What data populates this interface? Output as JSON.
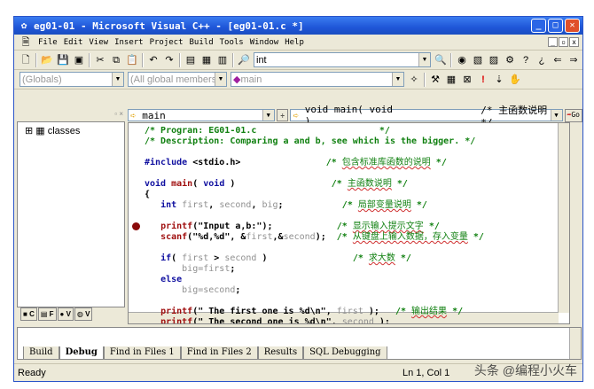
{
  "window": {
    "title": "eg01-01 - Microsoft Visual C++ - [eg01-01.c *]"
  },
  "menu": [
    "File",
    "Edit",
    "View",
    "Insert",
    "Project",
    "Build",
    "Tools",
    "Window",
    "Help"
  ],
  "toolbar": {
    "find_value": "int"
  },
  "wizardbar": {
    "class_combo": "(Globals)",
    "filter_combo": "(All global members",
    "member_combo": "main"
  },
  "left_pane": {
    "tree_root": "classes",
    "tabs": [
      "C",
      "F",
      "V",
      "V"
    ]
  },
  "editor": {
    "scope_combo": "main",
    "func_combo": "void main( void )",
    "func_comment": "/* 主函数说明 */",
    "go_label": "Go"
  },
  "code": [
    [
      [
        "/* Progran: EG01-01.c                       */",
        "cm"
      ]
    ],
    [
      [
        "/* Description: Comparing a and b, see which is the bigger. */",
        "cm"
      ]
    ],
    [],
    [
      [
        "#include",
        "kw"
      ],
      [
        " <stdio.h>                ",
        "tx"
      ],
      [
        "/* ",
        "cm"
      ],
      [
        "包含标准库函数的说明",
        "cn"
      ],
      [
        " */",
        "cm"
      ]
    ],
    [],
    [
      [
        "void",
        "kw"
      ],
      [
        " ",
        "tx"
      ],
      [
        "main",
        "fn"
      ],
      [
        "( ",
        "tx"
      ],
      [
        "void",
        "kw"
      ],
      [
        " )                  ",
        "tx"
      ],
      [
        "/* ",
        "cm"
      ],
      [
        "主函数说明",
        "cn"
      ],
      [
        " */",
        "cm"
      ]
    ],
    [
      [
        "{",
        "tx"
      ]
    ],
    [
      [
        "   ",
        "tx"
      ],
      [
        "int",
        "kw"
      ],
      [
        " ",
        "tx"
      ],
      [
        "first",
        "id"
      ],
      [
        ", ",
        "tx"
      ],
      [
        "second",
        "id"
      ],
      [
        ", ",
        "tx"
      ],
      [
        "big",
        "id"
      ],
      [
        ";           ",
        "tx"
      ],
      [
        "/* ",
        "cm"
      ],
      [
        "局部变量说明",
        "cn"
      ],
      [
        " */",
        "cm"
      ]
    ],
    [],
    [
      [
        "   ",
        "tx"
      ],
      [
        "printf",
        "fn"
      ],
      [
        "(\"Input a,b:\");",
        "tx"
      ],
      [
        "            ",
        "tx"
      ],
      [
        "/* ",
        "cm"
      ],
      [
        "显示输入提示文字",
        "cn"
      ],
      [
        " */",
        "cm"
      ]
    ],
    [
      [
        "   ",
        "tx"
      ],
      [
        "scanf",
        "fn"
      ],
      [
        "(\"%d,%d\", &",
        "tx"
      ],
      [
        "first",
        "id"
      ],
      [
        ",&",
        "tx"
      ],
      [
        "second",
        "id"
      ],
      [
        ");  ",
        "tx"
      ],
      [
        "/* ",
        "cm"
      ],
      [
        "从键盘上输入数据，存入变量",
        "cn"
      ],
      [
        " */",
        "cm"
      ]
    ],
    [],
    [
      [
        "   ",
        "tx"
      ],
      [
        "if",
        "kw"
      ],
      [
        "( ",
        "tx"
      ],
      [
        "first",
        "id"
      ],
      [
        " > ",
        "tx"
      ],
      [
        "second",
        "id"
      ],
      [
        " )                ",
        "tx"
      ],
      [
        "/* ",
        "cm"
      ],
      [
        "求大数",
        "cn"
      ],
      [
        " */",
        "cm"
      ]
    ],
    [
      [
        "       ",
        "tx"
      ],
      [
        "big=first",
        "id"
      ],
      [
        ";",
        "tx"
      ]
    ],
    [
      [
        "   ",
        "tx"
      ],
      [
        "else",
        "kw"
      ]
    ],
    [
      [
        "       ",
        "tx"
      ],
      [
        "big=second",
        "id"
      ],
      [
        ";",
        "tx"
      ]
    ],
    [],
    [
      [
        "   ",
        "tx"
      ],
      [
        "printf",
        "fn"
      ],
      [
        "(\" The first one is %d\\n\", ",
        "tx"
      ],
      [
        "first",
        "id"
      ],
      [
        " );   ",
        "tx"
      ],
      [
        "/* ",
        "cm"
      ],
      [
        "输出结果",
        "cn"
      ],
      [
        " */",
        "cm"
      ]
    ],
    [
      [
        "   ",
        "tx"
      ],
      [
        "printf",
        "fn"
      ],
      [
        "(\" The second one is %d\\n\", ",
        "tx"
      ],
      [
        "second",
        "id"
      ],
      [
        " );",
        "tx"
      ]
    ]
  ],
  "output": {
    "tabs": [
      "Build",
      "Debug",
      "Find in Files 1",
      "Find in Files 2",
      "Results",
      "SQL Debugging"
    ],
    "active": "Debug"
  },
  "status": {
    "text": "Ready",
    "position": "Ln 1, Col 1"
  },
  "watermark": "头条 @编程小火车"
}
